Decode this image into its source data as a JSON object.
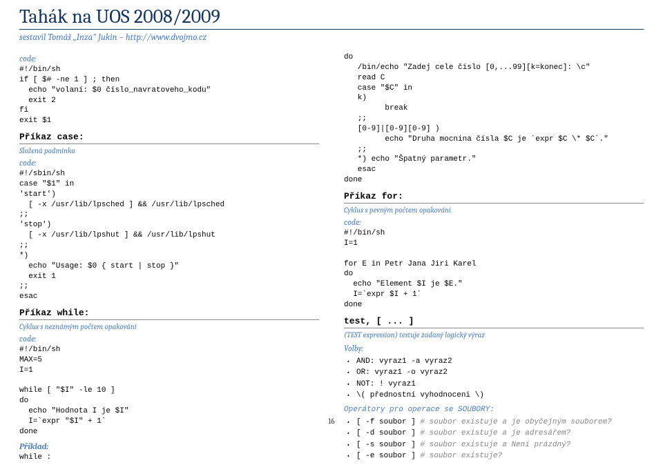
{
  "header": {
    "title": "Tahák na UOS 2008/2009",
    "subtitle": "sestavil Tomáš „Inza\" Jukin – http://www.dvojmo.cz"
  },
  "left": {
    "code1_label": "code:",
    "code1": "#!/bin/sh\nif [ $# -ne 1 ] ; then\n  echo \"volaní: $0 číslo_navratoveho_kodu\"\n  exit 2\nfi\nexit $1",
    "case_title": "Příkaz case:",
    "case_desc": "Složená podmínka",
    "code2_label": "code:",
    "code2": "#!/sbin/sh\ncase \"$1\" in\n'start')\n  [ -x /usr/lib/lpsched ] && /usr/lib/lpsched\n;;\n'stop')\n  [ -x /usr/lib/lpshut ] && /usr/lib/lpshut\n;;\n*)\n  echo \"Usage: $0 { start | stop }\"\n  exit 1\n;;\nesac",
    "while_title": "Příkaz while:",
    "while_desc": "Cyklus s neznámým počtem opakování",
    "code3_label": "code:",
    "code3": "#!/bin/sh\nMAX=5\nI=1\n\nwhile [ \"$I\" -le 10 ]\ndo\n  echo \"Hodnota I je $I\"\n  I=`expr \"$I\" + 1`\ndone",
    "example_label": "Příklad:",
    "code4": "while :"
  },
  "right": {
    "code1": "do\n   /bin/echo \"Zadej cele číslo [0,...99][k=konec]: \\c\"\n   read C\n   case \"$C\" in\n   k)\n         break\n   ;;\n   [0-9]|[0-9][0-9] )\n         echo \"Druha mocnina čísla $C je `expr $C \\* $C`.\"\n   ;;\n   *) echo \"Špatný parametr.\"\n   esac\ndone",
    "for_title": "Příkaz for:",
    "for_desc": "Cyklus s pevným počtem opakování",
    "code2_label": "code:",
    "code2": "#!/bin/sh\nI=1\n\nfor E in Petr Jana Jiri Karel\ndo\n  echo \"Element $I je $E.\"\n  I=`expr $I + 1`\ndone",
    "test_title": "test, [ ... ]",
    "test_desc": "(TEST expression) testuje zadaný logický výraz",
    "volby_label": "Volby:",
    "bullets1": [
      "AND: vyraz1 -a vyraz2",
      "OR: vyraz1 -o vyraz2",
      "NOT: ! vyraz1",
      "\\( přednostní vyhodnoceni \\)"
    ],
    "oper_label": "Operátory pro operace se SOUBORY:",
    "bullets2": [
      {
        "txt": "[ -f soubor ]",
        "cmt": " # soubor existuje a je obyčejným souborem?"
      },
      {
        "txt": "[ -d soubor ]",
        "cmt": " # soubor existuje a je adresářem?"
      },
      {
        "txt": "[ -s soubor ]",
        "cmt": " # soubor existuje a Není prázdný?"
      },
      {
        "txt": "[ -e soubor ]",
        "cmt": " # soubor existuje?"
      }
    ]
  },
  "pagenum": "16"
}
